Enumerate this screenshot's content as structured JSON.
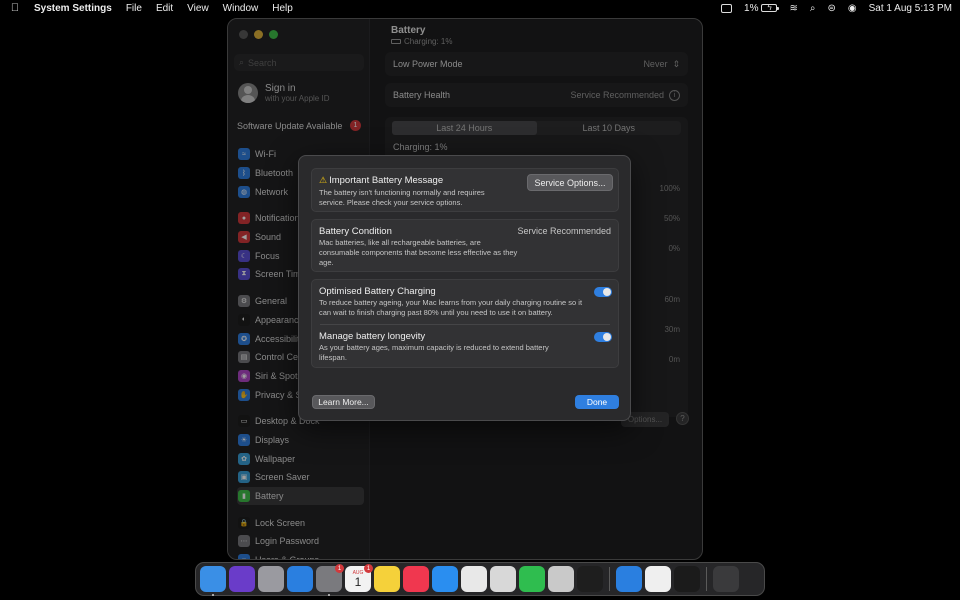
{
  "menubar": {
    "app_name": "System Settings",
    "items": [
      "File",
      "Edit",
      "View",
      "Window",
      "Help"
    ],
    "battery_percent": "1%",
    "datetime": "Sat 1 Aug  5:13 PM"
  },
  "sidebar": {
    "search_placeholder": "Search",
    "signin_title": "Sign in",
    "signin_sub": "with your Apple ID",
    "software_update": "Software Update Available",
    "software_update_badge": "1",
    "groups": [
      [
        {
          "label": "Wi-Fi",
          "icon": "wifi-icon",
          "color": "#2f7fe0",
          "glyph": "≈"
        },
        {
          "label": "Bluetooth",
          "icon": "bluetooth-icon",
          "color": "#2f7fe0",
          "glyph": "ᛒ"
        },
        {
          "label": "Network",
          "icon": "network-icon",
          "color": "#2f7fe0",
          "glyph": "◍"
        }
      ],
      [
        {
          "label": "Notifications",
          "icon": "notifications-icon",
          "color": "#d2393c",
          "glyph": "●"
        },
        {
          "label": "Sound",
          "icon": "sound-icon",
          "color": "#d2393c",
          "glyph": "◀"
        },
        {
          "label": "Focus",
          "icon": "focus-icon",
          "color": "#5b4fd6",
          "glyph": "☾"
        },
        {
          "label": "Screen Time",
          "icon": "screen-time-icon",
          "color": "#5b4fd6",
          "glyph": "⧗"
        }
      ],
      [
        {
          "label": "General",
          "icon": "general-gear-icon",
          "color": "#7a7a7e",
          "glyph": "⚙"
        },
        {
          "label": "Appearance",
          "icon": "appearance-icon",
          "color": "#1e1e1e",
          "glyph": "◐"
        },
        {
          "label": "Accessibility",
          "icon": "accessibility-icon",
          "color": "#2f7fe0",
          "glyph": "✪"
        },
        {
          "label": "Control Centre",
          "icon": "control-centre-icon",
          "color": "#7a7a7e",
          "glyph": "▤"
        },
        {
          "label": "Siri & Spotlight",
          "icon": "siri-icon",
          "color": "#b048c9",
          "glyph": "◉"
        },
        {
          "label": "Privacy & Security",
          "icon": "privacy-hand-icon",
          "color": "#2f7fe0",
          "glyph": "✋"
        }
      ],
      [
        {
          "label": "Desktop & Dock",
          "icon": "desktop-dock-icon",
          "color": "#1e1e1e",
          "glyph": "▭"
        },
        {
          "label": "Displays",
          "icon": "displays-icon",
          "color": "#2f7fe0",
          "glyph": "☀"
        },
        {
          "label": "Wallpaper",
          "icon": "wallpaper-icon",
          "color": "#3aa0d8",
          "glyph": "✿"
        },
        {
          "label": "Screen Saver",
          "icon": "screen-saver-icon",
          "color": "#3aa0d8",
          "glyph": "▣"
        },
        {
          "label": "Battery",
          "icon": "battery-icon",
          "color": "#3fbf4a",
          "glyph": "▮",
          "selected": true
        }
      ],
      [
        {
          "label": "Lock Screen",
          "icon": "lock-screen-icon",
          "color": "#1e1e1e",
          "glyph": "🔒"
        },
        {
          "label": "Login Password",
          "icon": "login-password-icon",
          "color": "#7a7a7e",
          "glyph": "⋯"
        },
        {
          "label": "Users & Groups",
          "icon": "users-groups-icon",
          "color": "#2f7fe0",
          "glyph": "☺"
        }
      ]
    ]
  },
  "main": {
    "title": "Battery",
    "subtitle": "Charging: 1%",
    "low_power_label": "Low Power Mode",
    "low_power_value": "Never",
    "health_label": "Battery Health",
    "health_value": "Service Recommended",
    "tab_24h": "Last 24 Hours",
    "tab_10d": "Last 10 Days",
    "charging_label": "Charging: 1%",
    "y_battery": [
      "100%",
      "50%",
      "0%"
    ],
    "y_usage": [
      "60m",
      "30m",
      "0m"
    ],
    "options_label": "Options...",
    "help_label": "?"
  },
  "dialog": {
    "msg_title": "Important Battery Message",
    "msg_desc": "The battery isn't functioning normally and requires service. Please check your service options.",
    "service_btn": "Service Options...",
    "cond_title": "Battery Condition",
    "cond_value": "Service Recommended",
    "cond_desc": "Mac batteries, like all rechargeable batteries, are consumable components that become less effective as they age.",
    "opt_title": "Optimised Battery Charging",
    "opt_desc": "To reduce battery ageing, your Mac learns from your daily charging routine so it can wait to finish charging past 80% until you need to use it on battery.",
    "longevity_title": "Manage battery longevity",
    "longevity_desc": "As your battery ages, maximum capacity is reduced to extend battery lifespan.",
    "learn_btn": "Learn More...",
    "done_btn": "Done"
  },
  "dock": {
    "calendar_month": "AUG",
    "calendar_day": "1",
    "settings_badge": "1",
    "calendar_badge": "1",
    "apps": [
      {
        "icon": "finder-icon",
        "color": "#3a8fe6"
      },
      {
        "icon": "siri-app-icon",
        "color": "#6a3cc9"
      },
      {
        "icon": "launchpad-icon",
        "color": "#9a9aa0"
      },
      {
        "icon": "safari-icon",
        "color": "#2a7fe0"
      },
      {
        "icon": "system-settings-icon",
        "color": "#7a7a7e"
      },
      {
        "icon": "calendar-icon",
        "color": "#f2f2f2"
      },
      {
        "icon": "notes-icon",
        "color": "#f5d13a"
      },
      {
        "icon": "music-icon",
        "color": "#f0374f"
      },
      {
        "icon": "mail-icon",
        "color": "#2a8ef0"
      },
      {
        "icon": "chrome-icon",
        "color": "#e8e8e8"
      },
      {
        "icon": "screenshot-icon",
        "color": "#d8d8d8"
      },
      {
        "icon": "whatsapp-icon",
        "color": "#2fbd4f"
      },
      {
        "icon": "preview-icon",
        "color": "#c9c9c9"
      },
      {
        "icon": "vlc-icon",
        "color": "#1e1e1e"
      },
      {
        "icon": "xcode-icon",
        "color": "#2a7fe0"
      },
      {
        "icon": "textedit-icon",
        "color": "#efefef"
      },
      {
        "icon": "terminal-icon",
        "color": "#1b1b1b"
      },
      {
        "icon": "trash-icon",
        "color": "#3a3a3c"
      }
    ]
  }
}
